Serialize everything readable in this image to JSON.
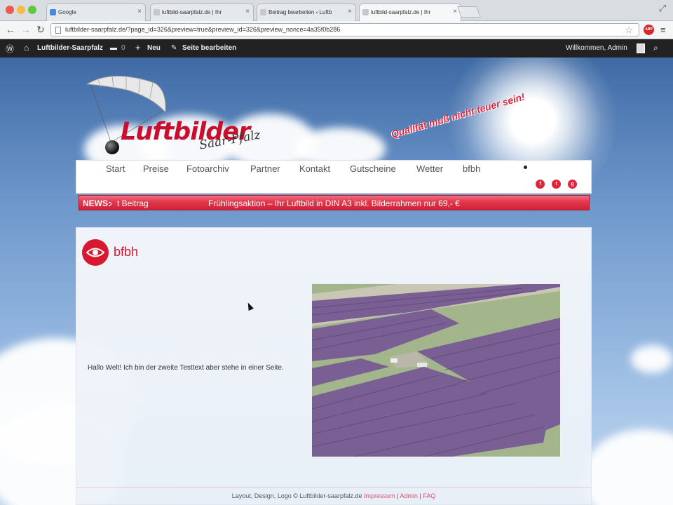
{
  "browser": {
    "tabs": [
      {
        "title": "Google",
        "favicon_color": "#4a88e8"
      },
      {
        "title": "luftbild-saarpfalz.de | Ihr",
        "favicon_color": "#c8c8c8"
      },
      {
        "title": "Beitrag bearbeiten ‹ Luftb",
        "favicon_color": "#c8c8c8"
      },
      {
        "title": "luftbild-saarpfalz.de | Ihr",
        "favicon_color": "#c8c8c8"
      }
    ],
    "url": "luftbilder-saarpfalz.de/?page_id=326&preview=true&preview_id=326&preview_nonce=4a35f0b286",
    "adblock_label": "ABP"
  },
  "adminbar": {
    "site_name": "Luftbilder-Saarpfalz",
    "comments_count": "0",
    "new_label": "Neu",
    "edit_label": "Seite bearbeiten",
    "greeting": "Willkommen, Admin"
  },
  "header": {
    "logo_text": "Luftbilder",
    "logo_sub": "Saar-Pfalz",
    "slogan": "Qualität muß nicht teuer sein!"
  },
  "nav": {
    "items": [
      "Start",
      "Preise",
      "Fotoarchiv",
      "Partner",
      "Kontakt",
      "Gutscheine",
      "Wetter",
      "bfbh"
    ],
    "social": [
      "f",
      "t",
      "g"
    ]
  },
  "ticker": {
    "label": "NEWS:",
    "item1": "t Beitrag",
    "item2": "Frühlingsaktion – Ihr Luftbild in DIN A3 inkl. Bilderrahmen nur 69,- €"
  },
  "content": {
    "title": "bfbh",
    "body": "Hallo Welt! Ich bin der zweite Testtext aber stehe in einer Seite.",
    "footer_prefix": "Layout, Design, Logo © Luftbilder-saarpfalz.de",
    "footer_links": [
      "Impressum",
      "Admin",
      "FAQ"
    ],
    "footer_sep": "|"
  },
  "colors": {
    "accent": "#d8182f",
    "adminbar": "#222222",
    "solar_panels": "#7a5f95"
  }
}
